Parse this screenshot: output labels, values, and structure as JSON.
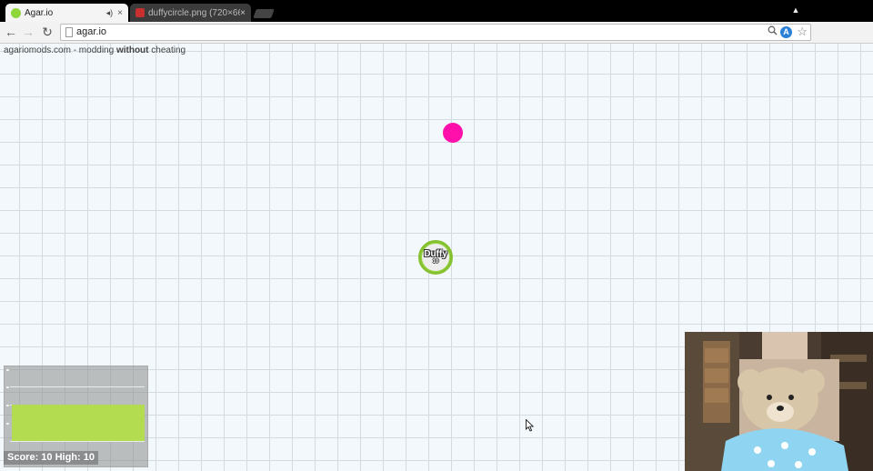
{
  "browser": {
    "tabs": [
      {
        "title": "Agar.io",
        "active": true,
        "favicon": "agario-favicon",
        "audio_icon": "◂)",
        "close": "×"
      },
      {
        "title": "duffycircle.png (720×661)",
        "active": false,
        "favicon": "image-favicon",
        "close": "×"
      }
    ],
    "profile_icon": "▲",
    "nav": {
      "back": "←",
      "forward": "→",
      "reload": "↻"
    },
    "address": {
      "url": "agar.io"
    },
    "omnibox_icons": {
      "zoom": "🔍",
      "extension_letter": "A",
      "star": "☆"
    },
    "menu_icon": "≡",
    "colors": {
      "accent_extension": "#2a7fd6",
      "record": "#ee2233"
    }
  },
  "game": {
    "banner": {
      "prefix": "agariomods.com - modding ",
      "bold": "without",
      "suffix": " cheating"
    },
    "pellet_color": "#ff10aa",
    "player": {
      "name": "Duffy",
      "mass": "10",
      "cell_color": "#9bd646"
    },
    "score": {
      "text": "Score: 10  High: 10"
    },
    "graph_color": "#b4dc50"
  },
  "webcam": {
    "present": true
  }
}
